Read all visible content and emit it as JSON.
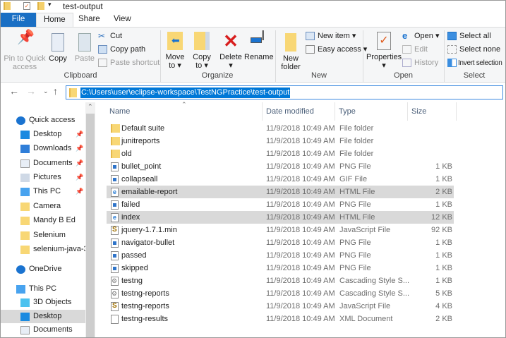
{
  "window": {
    "title": "test-output"
  },
  "tabs": [
    "File",
    "Home",
    "Share",
    "View"
  ],
  "ribbon": {
    "clipboard": {
      "label": "Clipboard",
      "pin": "Pin to Quick access",
      "copy": "Copy",
      "paste": "Paste",
      "cut": "Cut",
      "copy_path": "Copy path",
      "paste_shortcut": "Paste shortcut"
    },
    "organize": {
      "label": "Organize",
      "move_to": "Move to ▾",
      "copy_to": "Copy to ▾",
      "delete": "Delete ▾",
      "rename": "Rename"
    },
    "new": {
      "label": "New",
      "new_folder": "New folder",
      "new_item": "New item ▾",
      "easy_access": "Easy access ▾"
    },
    "open": {
      "label": "Open",
      "properties": "Properties ▾",
      "open": "Open ▾",
      "edit": "Edit",
      "history": "History"
    },
    "select": {
      "label": "Select",
      "select_all": "Select all",
      "select_none": "Select none",
      "invert": "Invert selection"
    }
  },
  "address": {
    "path": "C:\\Users\\user\\eclipse-workspace\\TestNGPractice\\test-output"
  },
  "nav": [
    {
      "label": "Quick access",
      "icon": "star-icon",
      "indent": 0,
      "pinned": false
    },
    {
      "label": "Desktop",
      "icon": "desktop-icon",
      "indent": 1,
      "pinned": true
    },
    {
      "label": "Downloads",
      "icon": "download-icon",
      "indent": 1,
      "pinned": true
    },
    {
      "label": "Documents",
      "icon": "documents-icon",
      "indent": 1,
      "pinned": true
    },
    {
      "label": "Pictures",
      "icon": "pictures-icon",
      "indent": 1,
      "pinned": true
    },
    {
      "label": "This PC",
      "icon": "computer-icon",
      "indent": 1,
      "pinned": true
    },
    {
      "label": "Camera",
      "icon": "folder-icon",
      "indent": 1,
      "pinned": false
    },
    {
      "label": "Mandy B Ed",
      "icon": "folder-icon",
      "indent": 1,
      "pinned": false
    },
    {
      "label": "Selenium",
      "icon": "folder-icon",
      "indent": 1,
      "pinned": false
    },
    {
      "label": "selenium-java-3",
      "icon": "folder-icon",
      "indent": 1,
      "pinned": false
    },
    {
      "label": "OneDrive",
      "icon": "cloud-icon",
      "indent": 0,
      "pinned": false
    },
    {
      "label": "This PC",
      "icon": "computer-icon",
      "indent": 0,
      "pinned": false
    },
    {
      "label": "3D Objects",
      "icon": "cube-icon",
      "indent": 1,
      "pinned": false
    },
    {
      "label": "Desktop",
      "icon": "desktop-icon",
      "indent": 1,
      "pinned": false,
      "selected": true
    },
    {
      "label": "Documents",
      "icon": "documents-icon",
      "indent": 1,
      "pinned": false
    }
  ],
  "columns": [
    "Name",
    "Date modified",
    "Type",
    "Size"
  ],
  "files": [
    {
      "name": "Default suite",
      "date": "11/9/2018 10:49 AM",
      "type": "File folder",
      "size": "",
      "kind": "folder"
    },
    {
      "name": "junitreports",
      "date": "11/9/2018 10:49 AM",
      "type": "File folder",
      "size": "",
      "kind": "folder"
    },
    {
      "name": "old",
      "date": "11/9/2018 10:49 AM",
      "type": "File folder",
      "size": "",
      "kind": "folder"
    },
    {
      "name": "bullet_point",
      "date": "11/9/2018 10:49 AM",
      "type": "PNG File",
      "size": "1 KB",
      "kind": "png"
    },
    {
      "name": "collapseall",
      "date": "11/9/2018 10:49 AM",
      "type": "GIF File",
      "size": "1 KB",
      "kind": "png"
    },
    {
      "name": "emailable-report",
      "date": "11/9/2018 10:49 AM",
      "type": "HTML File",
      "size": "2 KB",
      "kind": "html",
      "selected": true
    },
    {
      "name": "failed",
      "date": "11/9/2018 10:49 AM",
      "type": "PNG File",
      "size": "1 KB",
      "kind": "png"
    },
    {
      "name": "index",
      "date": "11/9/2018 10:49 AM",
      "type": "HTML File",
      "size": "12 KB",
      "kind": "html",
      "selected": true
    },
    {
      "name": "jquery-1.7.1.min",
      "date": "11/9/2018 10:49 AM",
      "type": "JavaScript File",
      "size": "92 KB",
      "kind": "js"
    },
    {
      "name": "navigator-bullet",
      "date": "11/9/2018 10:49 AM",
      "type": "PNG File",
      "size": "1 KB",
      "kind": "png"
    },
    {
      "name": "passed",
      "date": "11/9/2018 10:49 AM",
      "type": "PNG File",
      "size": "1 KB",
      "kind": "png"
    },
    {
      "name": "skipped",
      "date": "11/9/2018 10:49 AM",
      "type": "PNG File",
      "size": "1 KB",
      "kind": "png"
    },
    {
      "name": "testng",
      "date": "11/9/2018 10:49 AM",
      "type": "Cascading Style S...",
      "size": "1 KB",
      "kind": "css"
    },
    {
      "name": "testng-reports",
      "date": "11/9/2018 10:49 AM",
      "type": "Cascading Style S...",
      "size": "5 KB",
      "kind": "css"
    },
    {
      "name": "testng-reports",
      "date": "11/9/2018 10:49 AM",
      "type": "JavaScript File",
      "size": "4 KB",
      "kind": "js"
    },
    {
      "name": "testng-results",
      "date": "11/9/2018 10:49 AM",
      "type": "XML Document",
      "size": "2 KB",
      "kind": "xml"
    }
  ]
}
